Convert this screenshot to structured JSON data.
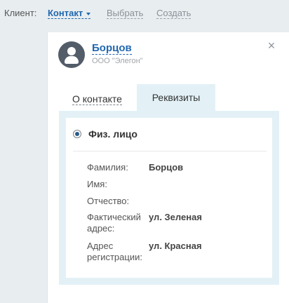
{
  "header": {
    "client_label": "Клиент:",
    "contact_label": "Контакт",
    "select_label": "Выбрать",
    "create_label": "Создать"
  },
  "card": {
    "name": "Борцов",
    "company": "ООО \"Элегон\"",
    "close_icon": "×",
    "tabs": [
      {
        "label": "О контакте",
        "active": false
      },
      {
        "label": "Реквизиты",
        "active": true
      }
    ]
  },
  "requisites": {
    "person_type": "Физ. лицо",
    "fields": [
      {
        "label": "Фамилия:",
        "value": "Борцов"
      },
      {
        "label": "Имя:",
        "value": ""
      },
      {
        "label": "Отчество:",
        "value": ""
      },
      {
        "label": "Фактический адрес:",
        "value": "ул. Зеленая"
      },
      {
        "label": "Адрес регистрации:",
        "value": "ул. Красная"
      }
    ]
  },
  "colors": {
    "link": "#2067b0",
    "tab_bg": "#e3f1f7",
    "page_bg": "#e8edf0",
    "avatar_bg": "#535c69"
  }
}
